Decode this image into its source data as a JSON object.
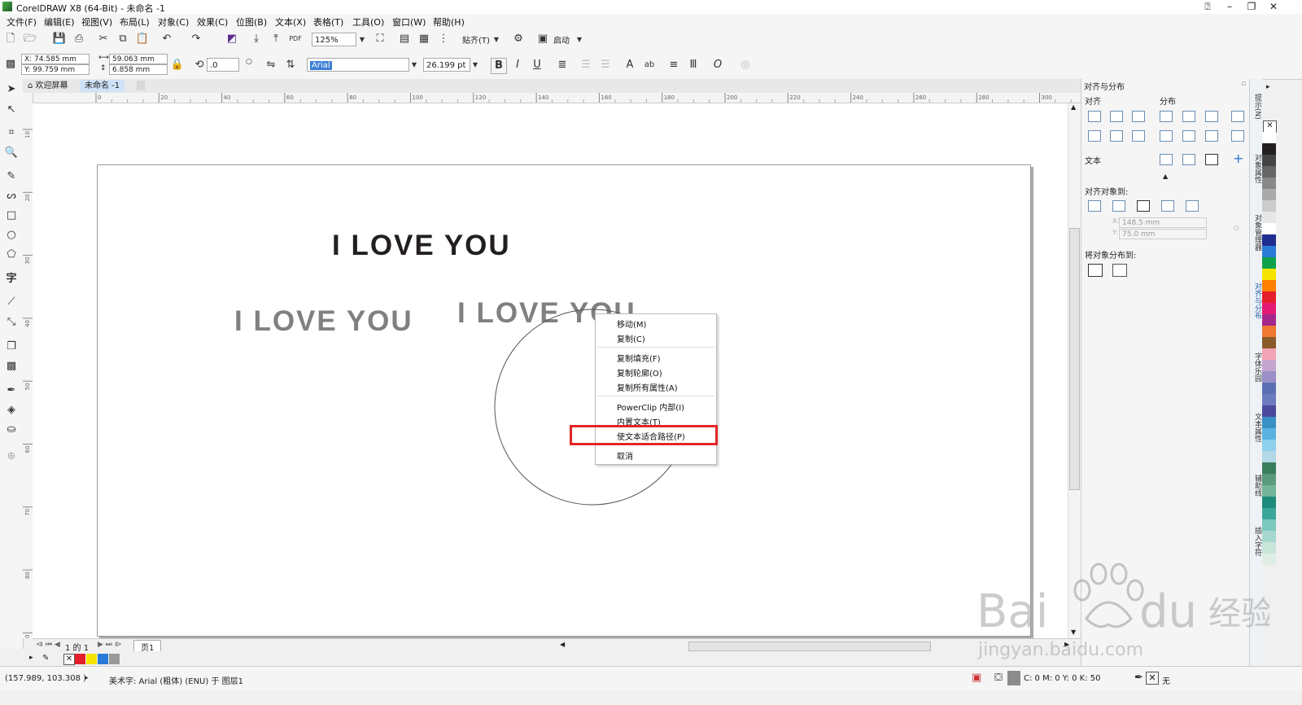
{
  "window": {
    "title": "CorelDRAW X8 (64-Bit) - 未命名 -1"
  },
  "menu": [
    "文件(F)",
    "编辑(E)",
    "视图(V)",
    "布局(L)",
    "对象(C)",
    "效果(C)",
    "位图(B)",
    "文本(X)",
    "表格(T)",
    "工具(O)",
    "窗口(W)",
    "帮助(H)"
  ],
  "toolbar1": {
    "zoom": "125%",
    "snap_label": "贴齐(T)",
    "launch_label": "启动"
  },
  "propbar": {
    "x": "X: 74.585 mm",
    "y": "Y: 99.759 mm",
    "w": "59.063 mm",
    "h": "6.858 mm",
    "rotation": ".0",
    "font": "Arial",
    "font_size": "26.199 pt"
  },
  "doc_tabs": {
    "welcome": "欢迎屏幕",
    "doc": "未命名 -1"
  },
  "ruler": {
    "h_labels": [
      "0",
      "20",
      "40",
      "60",
      "80",
      "100",
      "120",
      "140",
      "160",
      "180",
      "200",
      "220",
      "240",
      "260",
      "280",
      "300"
    ],
    "v_labels": [
      "10",
      "20",
      "30",
      "40",
      "50",
      "60",
      "70",
      "80",
      "90"
    ],
    "h_unit": "毫米"
  },
  "canvas": {
    "text1": "I LOVE YOU",
    "text2": "I LOVE YOU",
    "text3": "I LOVE YOU"
  },
  "context_menu": {
    "items": [
      "移动(M)",
      "复制(C)",
      "复制填充(F)",
      "复制轮廓(O)",
      "复制所有属性(A)",
      "PowerClip 内部(I)",
      "内置文本(T)",
      "使文本适合路径(P)",
      "取消"
    ]
  },
  "page_nav": {
    "counter": "1 的 1",
    "page_tab": "页1"
  },
  "status": {
    "coords": "(157.989, 103.308 )",
    "object_info": "美术字: Arial (粗体) (ENU) 于 图层1",
    "fill_info": "C: 0 M: 0 Y: 0 K: 50",
    "outline_info": "无"
  },
  "docker": {
    "title": "对齐与分布",
    "align_label": "对齐",
    "distribute_label": "分布",
    "text_label": "文本",
    "align_to_label": "对齐对象到:",
    "x_value": "148.5 mm",
    "y_value": "75.0 mm",
    "distribute_to_label": "将对象分布到:"
  },
  "docker_tabs": [
    "提示(N)",
    "对象属性",
    "对象管理器",
    "对齐与分布",
    "字体乐园",
    "文本属性",
    "辅助线",
    "插入字符"
  ],
  "palette": [
    "#ffffff",
    "#231f20",
    "#444444",
    "#666666",
    "#888888",
    "#aaaaaa",
    "#cccccc",
    "#e6e6e6",
    "#ffffff",
    "#1e2d8f",
    "#2a7ad8",
    "#0da04b",
    "#f5e300",
    "#ff7f00",
    "#e41e2a",
    "#e31a73",
    "#a4278b",
    "#f07830",
    "#8b5a2b",
    "#f3a4b5",
    "#c3a5cf",
    "#9a8fc7",
    "#5b6fb3",
    "#6c7bbd",
    "#4a4a9c",
    "#3a8fc4",
    "#59b3e2",
    "#8ed0ed",
    "#b3d8e8",
    "#3a7d5c",
    "#5a9a7d",
    "#72b59a",
    "#1c8b7a",
    "#3aa69a",
    "#7cc8bd",
    "#a7d8cf",
    "#c9e5da",
    "#dfeee4"
  ],
  "bottom_palette": [
    "#e41e2a",
    "#f5e300",
    "#2a7ad8",
    "#999999"
  ]
}
